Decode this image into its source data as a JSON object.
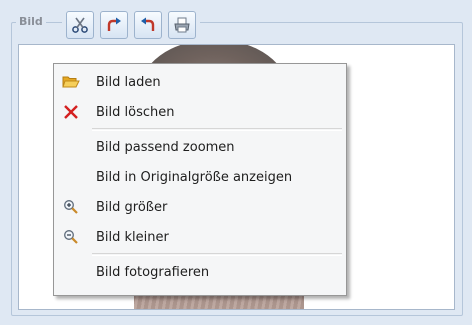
{
  "group": {
    "title": "Bild"
  },
  "toolbar": {
    "buttons": [
      {
        "icon": "scissors-icon"
      },
      {
        "icon": "redo-arrow-icon"
      },
      {
        "icon": "undo-arrow-icon"
      },
      {
        "icon": "printer-icon"
      }
    ]
  },
  "context_menu": {
    "items": [
      {
        "label": "Bild laden",
        "icon": "folder-open-icon"
      },
      {
        "label": "Bild löschen",
        "icon": "red-x-icon"
      },
      {
        "label": "Bild passend zoomen",
        "icon": ""
      },
      {
        "label": "Bild in Originalgröße anzeigen",
        "icon": ""
      },
      {
        "label": "Bild größer",
        "icon": "zoom-in-icon"
      },
      {
        "label": "Bild kleiner",
        "icon": "zoom-out-icon"
      },
      {
        "label": "Bild fotografieren",
        "icon": ""
      }
    ]
  },
  "colors": {
    "background": "#dfe8f3",
    "menu_background": "#f5f6f7",
    "delete_red": "#d42020",
    "folder_yellow": "#f3c144"
  }
}
